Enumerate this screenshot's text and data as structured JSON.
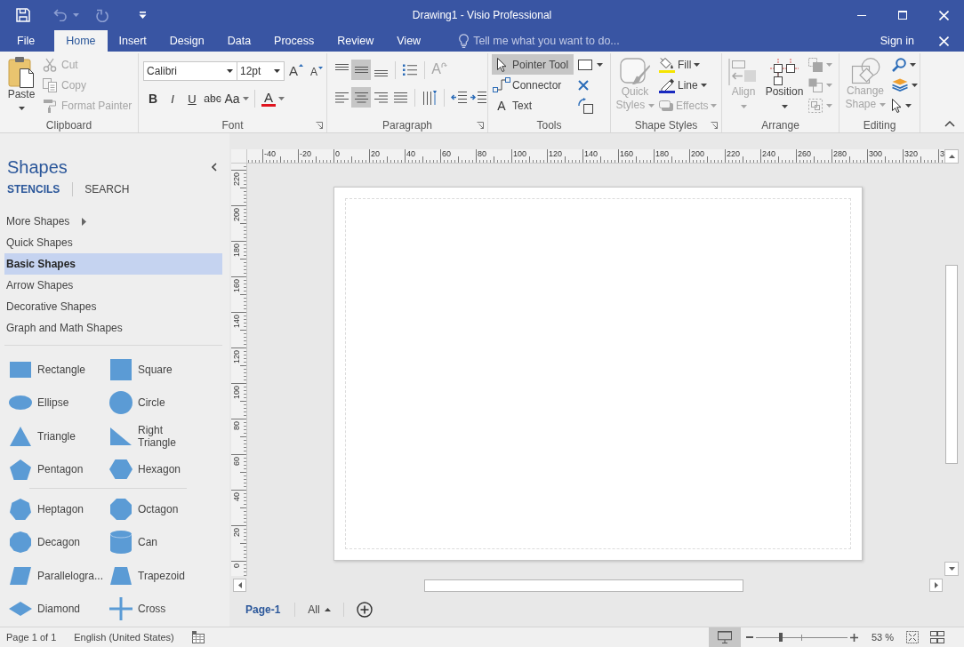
{
  "window": {
    "title": "Drawing1 - Visio Professional"
  },
  "quick_access": [
    {
      "kind": "save",
      "disabled": false
    },
    {
      "kind": "undo",
      "disabled": true
    },
    {
      "kind": "redo",
      "disabled": true
    },
    {
      "kind": "customize",
      "disabled": false
    }
  ],
  "ribbon_tabs": [
    {
      "label": "File",
      "selected": false
    },
    {
      "label": "Home",
      "selected": true
    },
    {
      "label": "Insert",
      "selected": false
    },
    {
      "label": "Design",
      "selected": false
    },
    {
      "label": "Data",
      "selected": false
    },
    {
      "label": "Process",
      "selected": false
    },
    {
      "label": "Review",
      "selected": false
    },
    {
      "label": "View",
      "selected": false
    }
  ],
  "tell_me": {
    "placeholder": "Tell me what you want to do..."
  },
  "account": {
    "label": "Sign in"
  },
  "ribbon": {
    "clipboard": {
      "label": "Clipboard",
      "paste": {
        "label": "Paste"
      },
      "commands": [
        {
          "kind": "cut",
          "label": "Cut",
          "disabled": true
        },
        {
          "kind": "copy",
          "label": "Copy",
          "disabled": true
        },
        {
          "kind": "format-painter",
          "label": "Format Painter",
          "disabled": true
        }
      ]
    },
    "font": {
      "label": "Font",
      "font_name": "Calibri",
      "font_size": "12pt",
      "size_buttons": [
        {
          "kind": "grow",
          "glyph": "A"
        },
        {
          "kind": "shrink",
          "glyph": "A"
        }
      ],
      "styles": [
        {
          "kind": "bold",
          "glyph": "B"
        },
        {
          "kind": "italic",
          "glyph": "I"
        },
        {
          "kind": "underline",
          "glyph": "U"
        },
        {
          "kind": "strikethrough",
          "glyph": "abc"
        },
        {
          "kind": "case",
          "glyph": "Aa"
        }
      ],
      "font_color": {
        "glyph": "A"
      }
    },
    "paragraph": {
      "label": "Paragraph",
      "vertical_align": [
        {
          "kind": "top",
          "selected": false
        },
        {
          "kind": "middle",
          "selected": true
        },
        {
          "kind": "bottom",
          "selected": false
        }
      ],
      "horizontal_align": [
        {
          "kind": "left",
          "selected": false
        },
        {
          "kind": "center",
          "selected": true
        },
        {
          "kind": "right",
          "selected": false
        },
        {
          "kind": "justify",
          "selected": false
        }
      ],
      "text_direction": {
        "glyph": "A",
        "disabled": true
      }
    },
    "tools": {
      "label": "Tools",
      "items": [
        {
          "kind": "pointer",
          "label": "Pointer Tool",
          "selected": true
        },
        {
          "kind": "connector",
          "label": "Connector",
          "selected": false
        },
        {
          "kind": "text",
          "label": "Text",
          "glyph": "A",
          "selected": false
        }
      ]
    },
    "shape_styles": {
      "label": "Shape Styles",
      "quick_styles": {
        "label": "Quick Styles",
        "disabled": true
      },
      "commands": [
        {
          "kind": "fill",
          "label": "Fill",
          "disabled": false
        },
        {
          "kind": "line",
          "label": "Line",
          "disabled": false
        },
        {
          "kind": "effects",
          "label": "Effects",
          "disabled": true
        }
      ]
    },
    "arrange": {
      "label": "Arrange",
      "commands": [
        {
          "kind": "align",
          "label": "Align",
          "disabled": true
        },
        {
          "kind": "position",
          "label": "Position",
          "disabled": false
        }
      ],
      "layer_buttons": [
        {
          "kind": "bring-forward",
          "disabled": true
        },
        {
          "kind": "send-backward",
          "disabled": true
        },
        {
          "kind": "group",
          "disabled": true
        }
      ]
    },
    "editing": {
      "label": "Editing",
      "change_shape": {
        "label": "Change Shape",
        "disabled": true
      },
      "tools": [
        {
          "kind": "find",
          "disabled": false
        },
        {
          "kind": "layers",
          "disabled": false
        },
        {
          "kind": "select",
          "disabled": false
        }
      ]
    }
  },
  "shapes_panel": {
    "title": "Shapes",
    "tabs": [
      {
        "label": "STENCILS",
        "selected": true
      },
      {
        "label": "SEARCH",
        "selected": false
      }
    ],
    "more_shapes": {
      "label": "More Shapes"
    },
    "stencils": [
      {
        "label": "Quick Shapes",
        "selected": false
      },
      {
        "label": "Basic Shapes",
        "selected": true
      },
      {
        "label": "Arrow Shapes",
        "selected": false
      },
      {
        "label": "Decorative Shapes",
        "selected": false
      },
      {
        "label": "Graph and Math Shapes",
        "selected": false
      }
    ],
    "shape_groups": [
      {
        "shapes": [
          {
            "kind": "rectangle",
            "label": "Rectangle"
          },
          {
            "kind": "square",
            "label": "Square"
          },
          {
            "kind": "ellipse",
            "label": "Ellipse"
          },
          {
            "kind": "circle",
            "label": "Circle"
          },
          {
            "kind": "triangle",
            "label": "Triangle"
          },
          {
            "kind": "right-triangle",
            "label": "Right Triangle"
          },
          {
            "kind": "pentagon",
            "label": "Pentagon"
          },
          {
            "kind": "hexagon",
            "label": "Hexagon"
          }
        ]
      },
      {
        "shapes": [
          {
            "kind": "heptagon",
            "label": "Heptagon"
          },
          {
            "kind": "octagon",
            "label": "Octagon"
          },
          {
            "kind": "decagon",
            "label": "Decagon"
          },
          {
            "kind": "can",
            "label": "Can"
          },
          {
            "kind": "parallelogram",
            "label": "Parallelogra..."
          },
          {
            "kind": "trapezoid",
            "label": "Trapezoid"
          },
          {
            "kind": "diamond",
            "label": "Diamond"
          },
          {
            "kind": "cross",
            "label": "Cross"
          }
        ]
      }
    ]
  },
  "canvas": {
    "horizontal_ruler": [
      "-40",
      "-20",
      "0",
      "20",
      "40",
      "60",
      "80",
      "100",
      "120",
      "140",
      "160",
      "180",
      "200",
      "220",
      "240",
      "260",
      "280",
      "300",
      "320",
      "3"
    ],
    "vertical_ruler": [
      "220",
      "200",
      "180",
      "160",
      "140",
      "120",
      "100",
      "80",
      "60",
      "40",
      "20",
      "0"
    ]
  },
  "page_tabs": {
    "pages": [
      {
        "label": "Page-1",
        "selected": true
      }
    ],
    "all": {
      "label": "All"
    }
  },
  "status_bar": {
    "page": "Page 1 of 1",
    "language": "English (United States)",
    "zoom": {
      "level": 0.27,
      "reading": "53 %"
    }
  }
}
